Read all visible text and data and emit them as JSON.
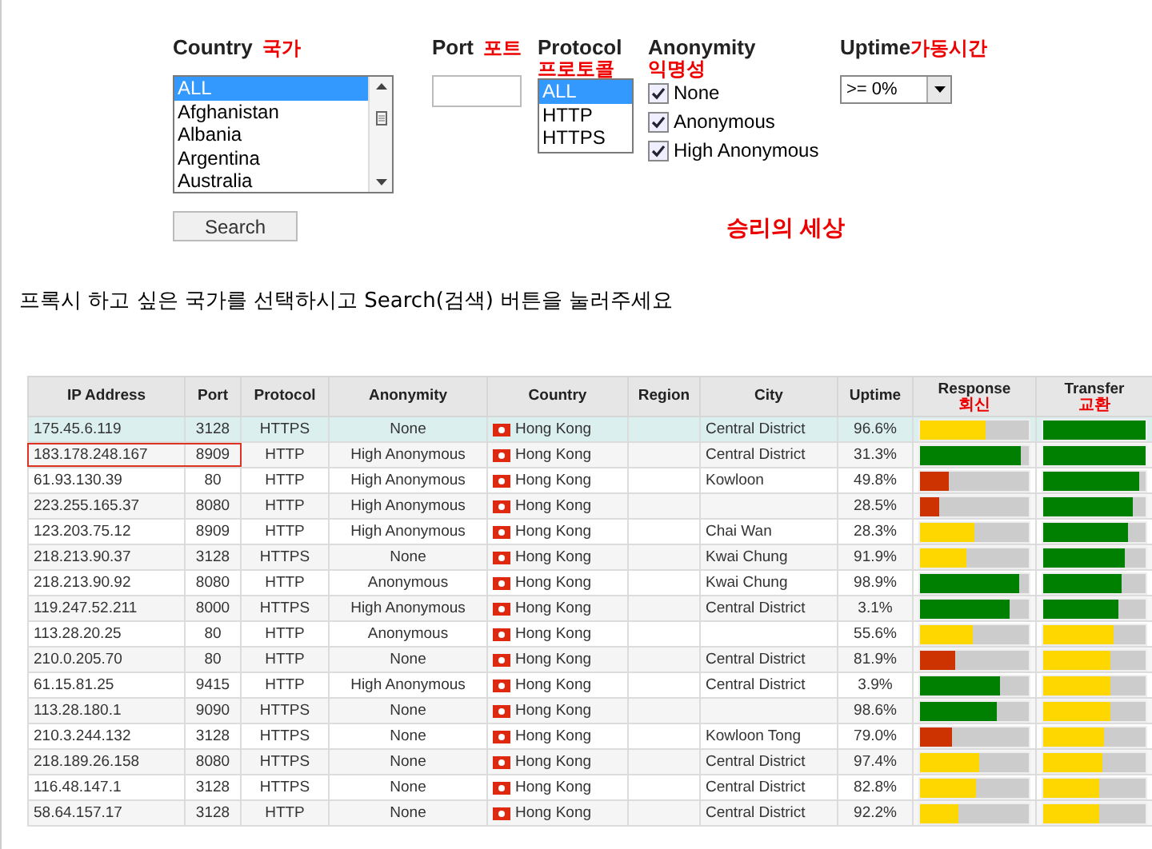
{
  "filters": {
    "country": {
      "label": "Country",
      "note": "국가",
      "options": [
        {
          "label": "ALL",
          "selected": true
        },
        {
          "label": "Afghanistan",
          "selected": false
        },
        {
          "label": "Albania",
          "selected": false
        },
        {
          "label": "Argentina",
          "selected": false
        },
        {
          "label": "Australia",
          "selected": false
        }
      ]
    },
    "port": {
      "label": "Port",
      "note": "포트"
    },
    "protocol": {
      "label": "Protocol",
      "note": "프로토콜",
      "options": [
        {
          "label": "ALL",
          "selected": true
        },
        {
          "label": "HTTP",
          "selected": false
        },
        {
          "label": "HTTPS",
          "selected": false
        }
      ]
    },
    "anonymity": {
      "label": "Anonymity",
      "note": "익명성",
      "options": [
        {
          "label": "None",
          "checked": true
        },
        {
          "label": "Anonymous",
          "checked": true
        },
        {
          "label": "High Anonymous",
          "checked": true
        }
      ]
    },
    "uptime": {
      "label": "Uptime",
      "note": "가동시간",
      "value": ">= 0%"
    },
    "search_button": "Search",
    "watermark_note": "승리의 세상"
  },
  "instruction": "프록시 하고 싶은 국가를 선택하시고 Search(검색) 버튼을 눌러주세요",
  "table": {
    "columns": [
      {
        "label": "IP Address"
      },
      {
        "label": "Port"
      },
      {
        "label": "Protocol"
      },
      {
        "label": "Anonymity"
      },
      {
        "label": "Country"
      },
      {
        "label": "Region"
      },
      {
        "label": "City"
      },
      {
        "label": "Uptime"
      },
      {
        "label": "Response",
        "note": "회신"
      },
      {
        "label": "Transfer",
        "note": "교환"
      }
    ],
    "rows": [
      {
        "ip": "175.45.6.119",
        "port": "3128",
        "protocol": "HTTPS",
        "anonymity": "None",
        "country": "Hong Kong",
        "city": "Central District",
        "uptime": "96.6%",
        "response": {
          "level": 0.61,
          "color": "#ffd700"
        },
        "transfer": {
          "level": 1.0,
          "color": "#008000"
        },
        "selected": true,
        "outlined": false
      },
      {
        "ip": "183.178.248.167",
        "port": "8909",
        "protocol": "HTTP",
        "anonymity": "High Anonymous",
        "country": "Hong Kong",
        "city": "Central District",
        "uptime": "31.3%",
        "response": {
          "level": 0.93,
          "color": "#008000"
        },
        "transfer": {
          "level": 1.0,
          "color": "#008000"
        },
        "selected": false,
        "outlined": true
      },
      {
        "ip": "61.93.130.39",
        "port": "80",
        "protocol": "HTTP",
        "anonymity": "High Anonymous",
        "country": "Hong Kong",
        "city": "Kowloon",
        "uptime": "49.8%",
        "response": {
          "level": 0.26,
          "color": "#cc3300"
        },
        "transfer": {
          "level": 0.93,
          "color": "#008000"
        },
        "selected": false,
        "outlined": false
      },
      {
        "ip": "223.255.165.37",
        "port": "8080",
        "protocol": "HTTP",
        "anonymity": "High Anonymous",
        "country": "Hong Kong",
        "uptime": "28.5%",
        "response": {
          "level": 0.18,
          "color": "#cc3300"
        },
        "transfer": {
          "level": 0.87,
          "color": "#008000"
        },
        "selected": false,
        "outlined": false
      },
      {
        "ip": "123.203.75.12",
        "port": "8909",
        "protocol": "HTTP",
        "anonymity": "High Anonymous",
        "country": "Hong Kong",
        "city": "Chai Wan",
        "uptime": "28.3%",
        "response": {
          "level": 0.5,
          "color": "#ffd700"
        },
        "transfer": {
          "level": 0.83,
          "color": "#008000"
        },
        "selected": false,
        "outlined": false
      },
      {
        "ip": "218.213.90.37",
        "port": "3128",
        "protocol": "HTTPS",
        "anonymity": "None",
        "country": "Hong Kong",
        "city": "Kwai Chung",
        "uptime": "91.9%",
        "response": {
          "level": 0.42,
          "color": "#ffd700"
        },
        "transfer": {
          "level": 0.79,
          "color": "#008000"
        },
        "selected": false,
        "outlined": false
      },
      {
        "ip": "218.213.90.92",
        "port": "8080",
        "protocol": "HTTP",
        "anonymity": "Anonymous",
        "country": "Hong Kong",
        "city": "Kwai Chung",
        "uptime": "98.9%",
        "response": {
          "level": 0.91,
          "color": "#008000"
        },
        "transfer": {
          "level": 0.77,
          "color": "#008000"
        },
        "selected": false,
        "outlined": false
      },
      {
        "ip": "119.247.52.211",
        "port": "8000",
        "protocol": "HTTPS",
        "anonymity": "High Anonymous",
        "country": "Hong Kong",
        "city": "Central District",
        "uptime": "3.1%",
        "response": {
          "level": 0.82,
          "color": "#008000"
        },
        "transfer": {
          "level": 0.73,
          "color": "#008000"
        },
        "selected": false,
        "outlined": false
      },
      {
        "ip": "113.28.20.25",
        "port": "80",
        "protocol": "HTTP",
        "anonymity": "Anonymous",
        "country": "Hong Kong",
        "uptime": "55.6%",
        "response": {
          "level": 0.49,
          "color": "#ffd700"
        },
        "transfer": {
          "level": 0.68,
          "color": "#ffd700"
        },
        "selected": false,
        "outlined": false
      },
      {
        "ip": "210.0.205.70",
        "port": "80",
        "protocol": "HTTP",
        "anonymity": "None",
        "country": "Hong Kong",
        "city": "Central District",
        "uptime": "81.9%",
        "response": {
          "level": 0.32,
          "color": "#cc3300"
        },
        "transfer": {
          "level": 0.66,
          "color": "#ffd700"
        },
        "selected": false,
        "outlined": false
      },
      {
        "ip": "61.15.81.25",
        "port": "9415",
        "protocol": "HTTP",
        "anonymity": "High Anonymous",
        "country": "Hong Kong",
        "city": "Central District",
        "uptime": "3.9%",
        "response": {
          "level": 0.73,
          "color": "#008000"
        },
        "transfer": {
          "level": 0.66,
          "color": "#ffd700"
        },
        "selected": false,
        "outlined": false
      },
      {
        "ip": "113.28.180.1",
        "port": "9090",
        "protocol": "HTTPS",
        "anonymity": "None",
        "country": "Hong Kong",
        "uptime": "98.6%",
        "response": {
          "level": 0.7,
          "color": "#008000"
        },
        "transfer": {
          "level": 0.65,
          "color": "#ffd700"
        },
        "selected": false,
        "outlined": false
      },
      {
        "ip": "210.3.244.132",
        "port": "3128",
        "protocol": "HTTPS",
        "anonymity": "None",
        "country": "Hong Kong",
        "city": "Kowloon Tong",
        "uptime": "79.0%",
        "response": {
          "level": 0.29,
          "color": "#cc3300"
        },
        "transfer": {
          "level": 0.6,
          "color": "#ffd700"
        },
        "selected": false,
        "outlined": false
      },
      {
        "ip": "218.189.26.158",
        "port": "8080",
        "protocol": "HTTPS",
        "anonymity": "None",
        "country": "Hong Kong",
        "city": "Central District",
        "uptime": "97.4%",
        "response": {
          "level": 0.55,
          "color": "#ffd700"
        },
        "transfer": {
          "level": 0.58,
          "color": "#ffd700"
        },
        "selected": false,
        "outlined": false
      },
      {
        "ip": "116.48.147.1",
        "port": "3128",
        "protocol": "HTTPS",
        "anonymity": "None",
        "country": "Hong Kong",
        "city": "Central District",
        "uptime": "82.8%",
        "response": {
          "level": 0.52,
          "color": "#ffd700"
        },
        "transfer": {
          "level": 0.55,
          "color": "#ffd700"
        },
        "selected": false,
        "outlined": false
      },
      {
        "ip": "58.64.157.17",
        "port": "3128",
        "protocol": "HTTP",
        "anonymity": "None",
        "country": "Hong Kong",
        "city": "Central District",
        "uptime": "92.2%",
        "response": {
          "level": 0.35,
          "color": "#ffd700"
        },
        "transfer": {
          "level": 0.55,
          "color": "#ffd700"
        },
        "selected": false,
        "outlined": false
      }
    ]
  }
}
